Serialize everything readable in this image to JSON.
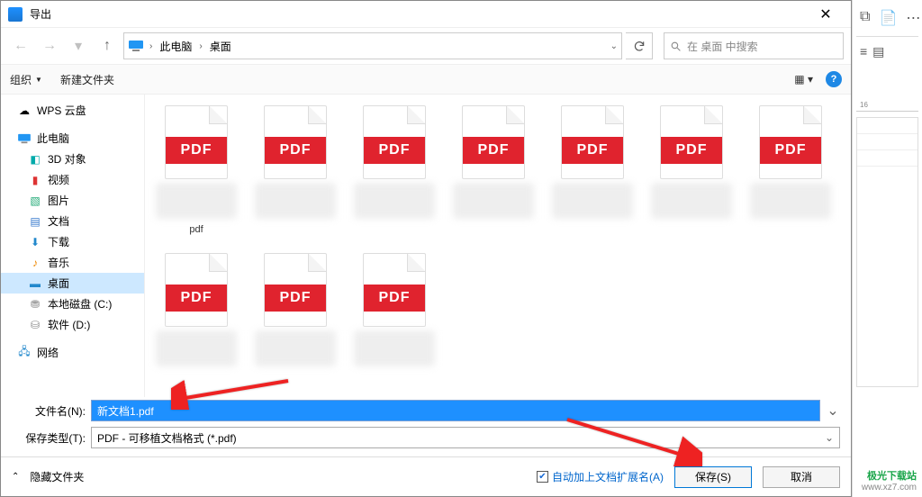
{
  "title": "导出",
  "breadcrumb": {
    "root_sep": "›",
    "pc": "此电脑",
    "desktop": "桌面"
  },
  "search": {
    "placeholder": "在 桌面 中搜索"
  },
  "toolbar": {
    "organize": "组织",
    "newfolder": "新建文件夹"
  },
  "tree": {
    "wps": "WPS 云盘",
    "pc": "此电脑",
    "objects3d": "3D 对象",
    "videos": "视频",
    "pictures": "图片",
    "documents": "文档",
    "downloads": "下载",
    "music": "音乐",
    "desktop": "桌面",
    "diskC": "本地磁盘 (C:)",
    "diskD": "软件 (D:)",
    "network": "网络"
  },
  "pdfband": "PDF",
  "row1_label": "pdf",
  "form": {
    "filename_label": "文件名(N):",
    "filename_value": "新文档1.pdf",
    "type_label": "保存类型(T):",
    "type_value": "PDF - 可移植文档格式 (*.pdf)"
  },
  "bottom": {
    "hide": "隐藏文件夹",
    "autoext": "自动加上文档扩展名(A)",
    "save": "保存(S)",
    "cancel": "取消"
  },
  "ruler_tick": "16",
  "watermark": {
    "l1": "极光下载站",
    "l2": "www.xz7.com"
  },
  "chart_data": null
}
